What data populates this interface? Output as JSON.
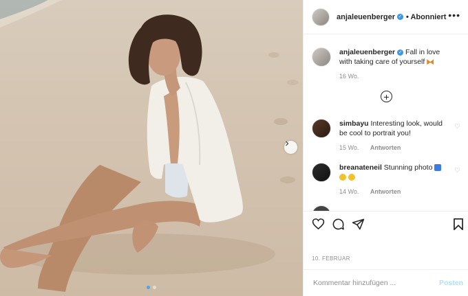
{
  "header": {
    "username": "anjaleuenberger",
    "follow_status": "• Abonniert",
    "more_icon": "more-horizontal-icon"
  },
  "caption": {
    "username": "anjaleuenberger",
    "text": "Fall in love with taking care of yourself",
    "emoji": "butterfly",
    "time": "16 Wo."
  },
  "comments": [
    {
      "username": "simbayu",
      "text": "Interesting look, would be cool to portrait you!",
      "time": "15 Wo.",
      "reply": "Antworten"
    },
    {
      "username": "breanateneil",
      "text": "Stunning photo",
      "time": "14 Wo.",
      "reply": "Antworten"
    }
  ],
  "post_date": "10. FEBRUAR",
  "composer": {
    "placeholder": "Kommentar hinzufügen ...",
    "post_label": "Posten"
  },
  "carousel": {
    "slides": 2,
    "active": 0
  },
  "colors": {
    "accent": "#3897f0",
    "post_disabled": "#b2dffc"
  }
}
